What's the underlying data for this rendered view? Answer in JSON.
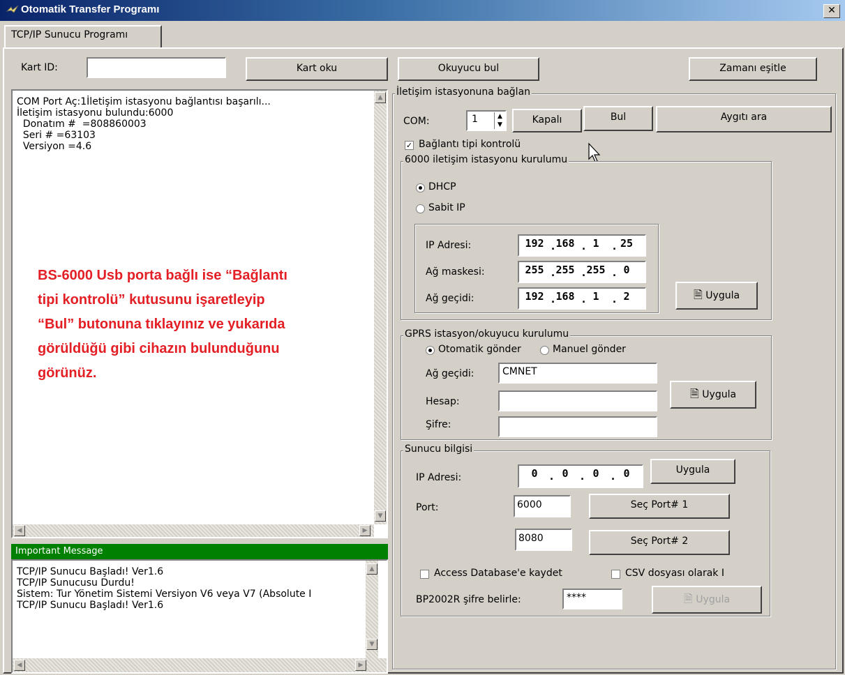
{
  "window": {
    "title": "Otomatik Transfer Programı",
    "close_glyph": "✕"
  },
  "tab": {
    "label": "TCP/IP Sunucu Programı"
  },
  "top": {
    "kart_id_label": "Kart ID:",
    "kart_id_value": "",
    "kart_oku_label": "Kart oku",
    "okuyucu_bul_label": "Okuyucu bul",
    "zamani_esitle_label": "Zamanı eşitle"
  },
  "log": {
    "lines": [
      "COM Port Aç:1İletişim istasyonu bağlantısı başarılı...",
      "İletişim istasyonu bulundu:6000",
      "  Donatım #  =808860003",
      "  Seri # =63103",
      "  Versiyon =4.6"
    ]
  },
  "annotation": {
    "lines": [
      "BS-6000 Usb porta bağlı ise “Bağlantı",
      "tipi kontrolü” kutusunu işaretleyip",
      "“Bul” butonuna tıklayınız ve yukarıda",
      "görüldüğü gibi cihazın bulunduğunu",
      "görünüz."
    ]
  },
  "important": {
    "header": "Important Message",
    "lines": [
      "TCP/IP Sunucu Başladı! Ver1.6",
      "TCP/IP Sunucusu Durdu!",
      "Sistem: Tur Yönetim Sistemi Versiyon V6 veya V7 (Absolute I",
      "TCP/IP Sunucu Başladı! Ver1.6"
    ]
  },
  "connect": {
    "legend": "İletişim istasyonuna bağlan",
    "com_label": "COM:",
    "com_value": "1",
    "kapali_label": "Kapalı",
    "bul_label": "Bul",
    "aygiti_ara_label": "Aygıtı ara",
    "baglanti_label": "Bağlantı tipi kontrolü",
    "baglanti_checked": true
  },
  "setup6000": {
    "legend": "6000 iletişim istasyonu kurulumu",
    "dhcp_label": "DHCP",
    "sabit_label": "Sabit IP",
    "ip_label": "IP Adresi:",
    "ip": [
      "192",
      "168",
      "1",
      "25"
    ],
    "mask_label": "Ağ maskesi:",
    "mask": [
      "255",
      "255",
      "255",
      "0"
    ],
    "gw_label": "Ağ geçidi:",
    "gw": [
      "192",
      "168",
      "1",
      "2"
    ],
    "apply_label": "Uygula"
  },
  "gprs": {
    "legend": "GPRS istasyon/okuyucu kurulumu",
    "auto_label": "Otomatik gönder",
    "manual_label": "Manuel gönder",
    "gw_label": "Ağ geçidi:",
    "gw_value": "CMNET",
    "hesap_label": "Hesap:",
    "hesap_value": "",
    "sifre_label": "Şifre:",
    "sifre_value": "",
    "apply_label": "Uygula"
  },
  "server": {
    "legend": "Sunucu bilgisi",
    "ip_label": "IP Adresi:",
    "ip": [
      "0",
      "0",
      "0",
      "0"
    ],
    "apply_label": "Uygula",
    "port_label": "Port:",
    "port1_value": "6000",
    "port1_btn": "Seç Port# 1",
    "port2_value": "8080",
    "port2_btn": "Seç Port# 2",
    "access_label": "Access Database'e kaydet",
    "csv_label": "CSV dosyası olarak I",
    "bp_label": "BP2002R şifre belirle:",
    "bp_value": "****",
    "bp_apply_label": "Uygula"
  },
  "colors": {
    "annotation": "#e31e24",
    "important_header": "#008000",
    "title_bar": "#0a246a"
  }
}
